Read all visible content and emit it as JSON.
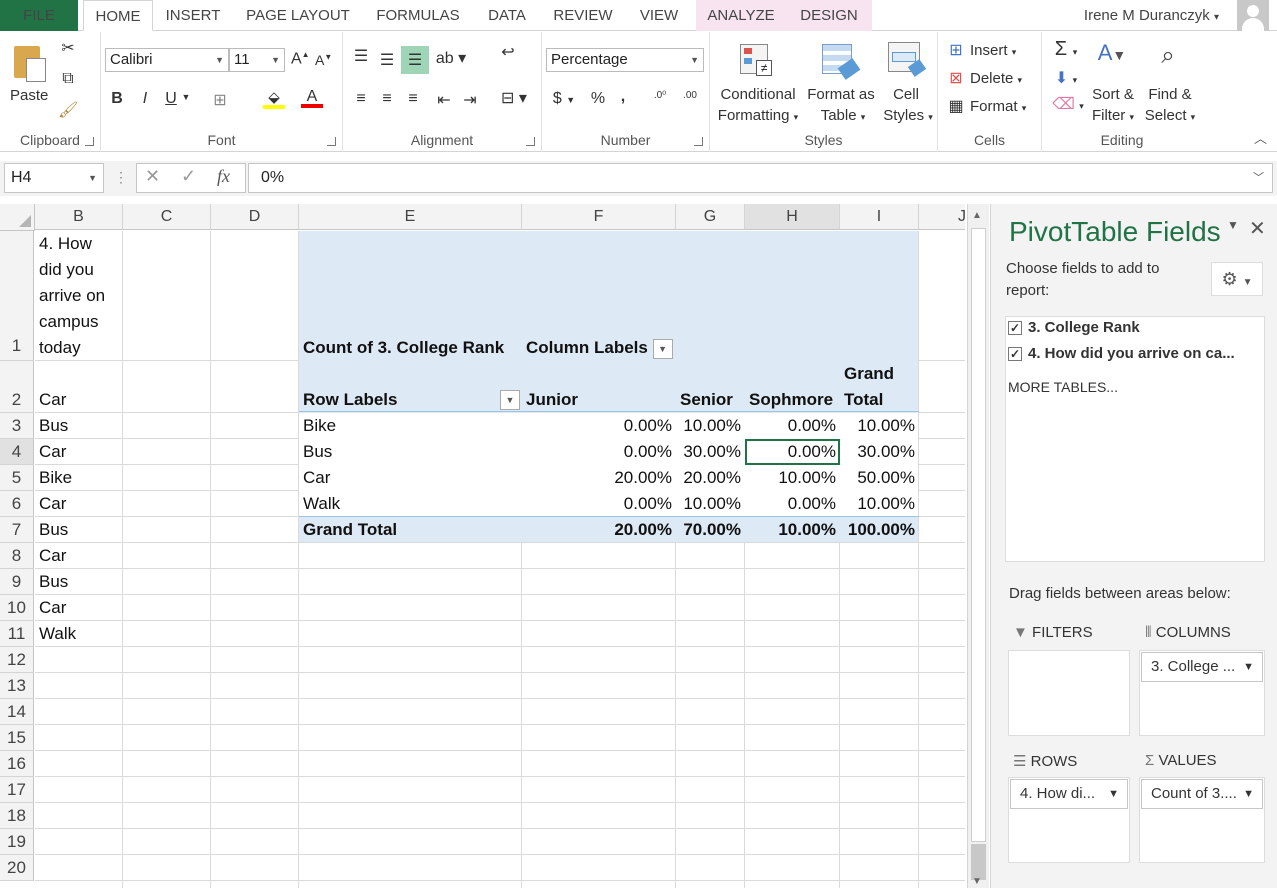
{
  "tabs": {
    "file": "FILE",
    "home": "HOME",
    "insert": "INSERT",
    "page_layout": "PAGE LAYOUT",
    "formulas": "FORMULAS",
    "data": "DATA",
    "review": "REVIEW",
    "view": "VIEW",
    "analyze": "ANALYZE",
    "design": "DESIGN"
  },
  "user": {
    "name": "Irene M Duranczyk",
    "caret": "▾"
  },
  "ribbon": {
    "clipboard": {
      "label": "Clipboard",
      "paste": "Paste"
    },
    "font": {
      "label": "Font",
      "name": "Calibri",
      "size": "11",
      "bold": "B",
      "italic": "I",
      "underline": "U"
    },
    "alignment": {
      "label": "Alignment"
    },
    "number": {
      "label": "Number",
      "format": "Percentage",
      "currency": "$",
      "percent": "%",
      "comma": ","
    },
    "styles": {
      "label": "Styles",
      "conditional_1": "Conditional",
      "conditional_2": "Formatting",
      "format_table_1": "Format as",
      "format_table_2": "Table",
      "cell_styles_1": "Cell",
      "cell_styles_2": "Styles"
    },
    "cells": {
      "label": "Cells",
      "insert": "Insert",
      "delete": "Delete",
      "format": "Format"
    },
    "editing": {
      "label": "Editing",
      "sort_1": "Sort &",
      "sort_2": "Filter",
      "find_1": "Find &",
      "find_2": "Select"
    }
  },
  "formula_bar": {
    "name_box": "H4",
    "formula": "0%",
    "fx": "fx"
  },
  "columns": [
    "B",
    "C",
    "D",
    "E",
    "F",
    "G",
    "H",
    "I",
    "J"
  ],
  "rows": [
    "1",
    "2",
    "3",
    "4",
    "5",
    "6",
    "7",
    "8",
    "9",
    "10",
    "11",
    "12",
    "13",
    "14",
    "15",
    "16",
    "17",
    "18",
    "19",
    "20"
  ],
  "col_b": {
    "header_lines": [
      "4. How",
      "did you",
      "arrive on",
      "campus",
      "today"
    ],
    "values": [
      "Car",
      "Bus",
      "Car",
      "Bike",
      "Car",
      "Bus",
      "Car",
      "Bus",
      "Car",
      "Walk"
    ]
  },
  "pivot": {
    "title": "Count of 3. College Rank",
    "column_labels": "Column Labels",
    "row_labels": "Row Labels",
    "headers": [
      "Junior",
      "Senior",
      "Sophmore"
    ],
    "grand_total_1": "Grand",
    "grand_total_2": "Total",
    "rows": [
      {
        "label": "Bike",
        "values": [
          "0.00%",
          "10.00%",
          "0.00%",
          "10.00%"
        ]
      },
      {
        "label": "Bus",
        "values": [
          "0.00%",
          "30.00%",
          "0.00%",
          "30.00%"
        ]
      },
      {
        "label": "Car",
        "values": [
          "20.00%",
          "20.00%",
          "10.00%",
          "50.00%"
        ]
      },
      {
        "label": "Walk",
        "values": [
          "0.00%",
          "10.00%",
          "0.00%",
          "10.00%"
        ]
      }
    ],
    "grand_total_row": {
      "label": "Grand Total",
      "values": [
        "20.00%",
        "70.00%",
        "10.00%",
        "100.00%"
      ]
    }
  },
  "pane": {
    "title": "PivotTable Fields",
    "choose_1": "Choose fields to add to",
    "choose_2": "report:",
    "fields": [
      {
        "label": "3. College Rank",
        "checked": true
      },
      {
        "label": "4. How did you arrive on ca...",
        "checked": true
      }
    ],
    "more_tables": "MORE TABLES...",
    "drag_label": "Drag fields between areas below:",
    "filters": "FILTERS",
    "columns": "COLUMNS",
    "rows": "ROWS",
    "values": "VALUES",
    "columns_item": "3. College ...",
    "rows_item": "4. How di...",
    "values_item": "Count of 3...."
  }
}
